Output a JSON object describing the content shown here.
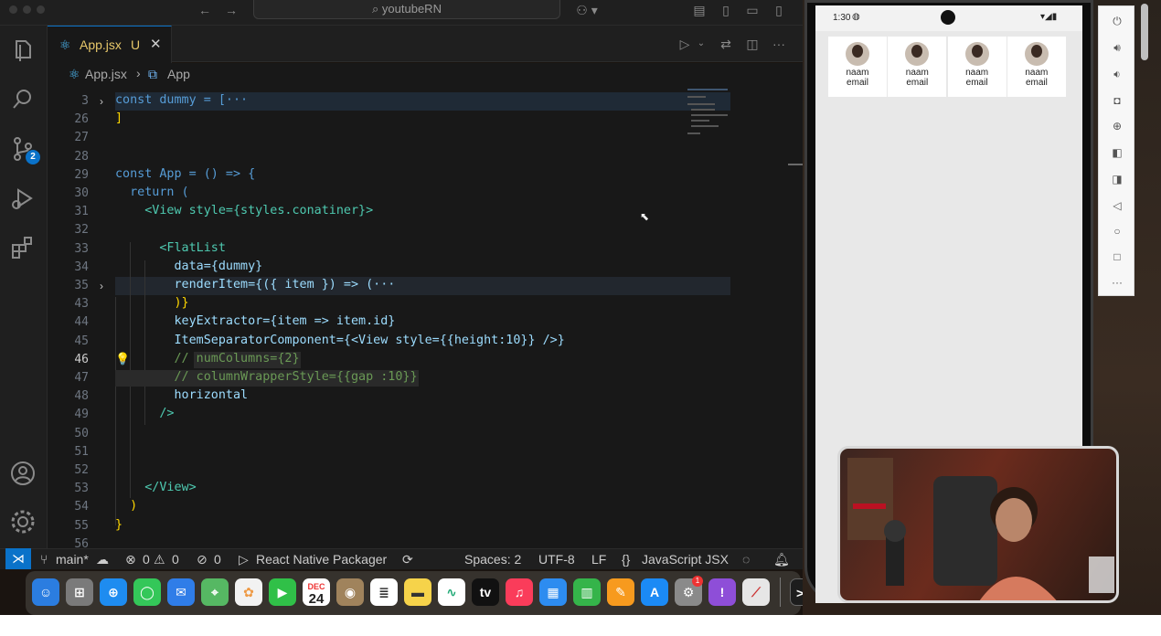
{
  "titlebar": {
    "search_text": "youtubeRN"
  },
  "activity": {
    "source_control_badge": "2"
  },
  "tab": {
    "filename": "App.jsx",
    "status": "U"
  },
  "breadcrumb": {
    "file": "App.jsx",
    "symbol": "App"
  },
  "editor": {
    "lines": [
      {
        "num": "3",
        "text": "const dummy = [···"
      },
      {
        "num": "26",
        "text": "]"
      },
      {
        "num": "27",
        "text": ""
      },
      {
        "num": "28",
        "text": ""
      },
      {
        "num": "29",
        "text": "const App = () => {"
      },
      {
        "num": "30",
        "text": "  return ("
      },
      {
        "num": "31",
        "text": "    <View style={styles.conatiner}>"
      },
      {
        "num": "32",
        "text": ""
      },
      {
        "num": "33",
        "text": "      <FlatList"
      },
      {
        "num": "34",
        "text": "        data={dummy}"
      },
      {
        "num": "35",
        "text": "        renderItem={({ item }) => (···"
      },
      {
        "num": "43",
        "text": "        )}"
      },
      {
        "num": "44",
        "text": "        keyExtractor={item => item.id}"
      },
      {
        "num": "45",
        "text": "        ItemSeparatorComponent={<View style={{height:10}} />}"
      },
      {
        "num": "46",
        "text": "        // numColumns={2}"
      },
      {
        "num": "47",
        "text": "        // columnWrapperStyle={{gap :10}}"
      },
      {
        "num": "48",
        "text": "        horizontal"
      },
      {
        "num": "49",
        "text": "      />"
      },
      {
        "num": "50",
        "text": ""
      },
      {
        "num": "51",
        "text": ""
      },
      {
        "num": "52",
        "text": ""
      },
      {
        "num": "53",
        "text": "    </View>"
      },
      {
        "num": "54",
        "text": "  )"
      },
      {
        "num": "55",
        "text": "}"
      },
      {
        "num": "56",
        "text": ""
      }
    ]
  },
  "statusbar": {
    "branch": "main*",
    "errors": "0",
    "warnings": "0",
    "ports": "0",
    "packager": "React Native Packager",
    "spaces": "Spaces: 2",
    "encoding": "UTF-8",
    "eol": "LF",
    "language": "JavaScript JSX"
  },
  "dock": {
    "calendar_month": "DEC",
    "calendar_day": "24",
    "settings_badge": "1"
  },
  "phone": {
    "time": "1:30",
    "cards": [
      {
        "name": "naam",
        "email": "email"
      },
      {
        "name": "naam",
        "email": "email"
      },
      {
        "name": "naam",
        "email": "email"
      },
      {
        "name": "naam",
        "email": "email"
      }
    ]
  },
  "colors": {
    "accent": "#0a72c9",
    "modified": "#e8c86a",
    "editor_bg": "#181818"
  }
}
